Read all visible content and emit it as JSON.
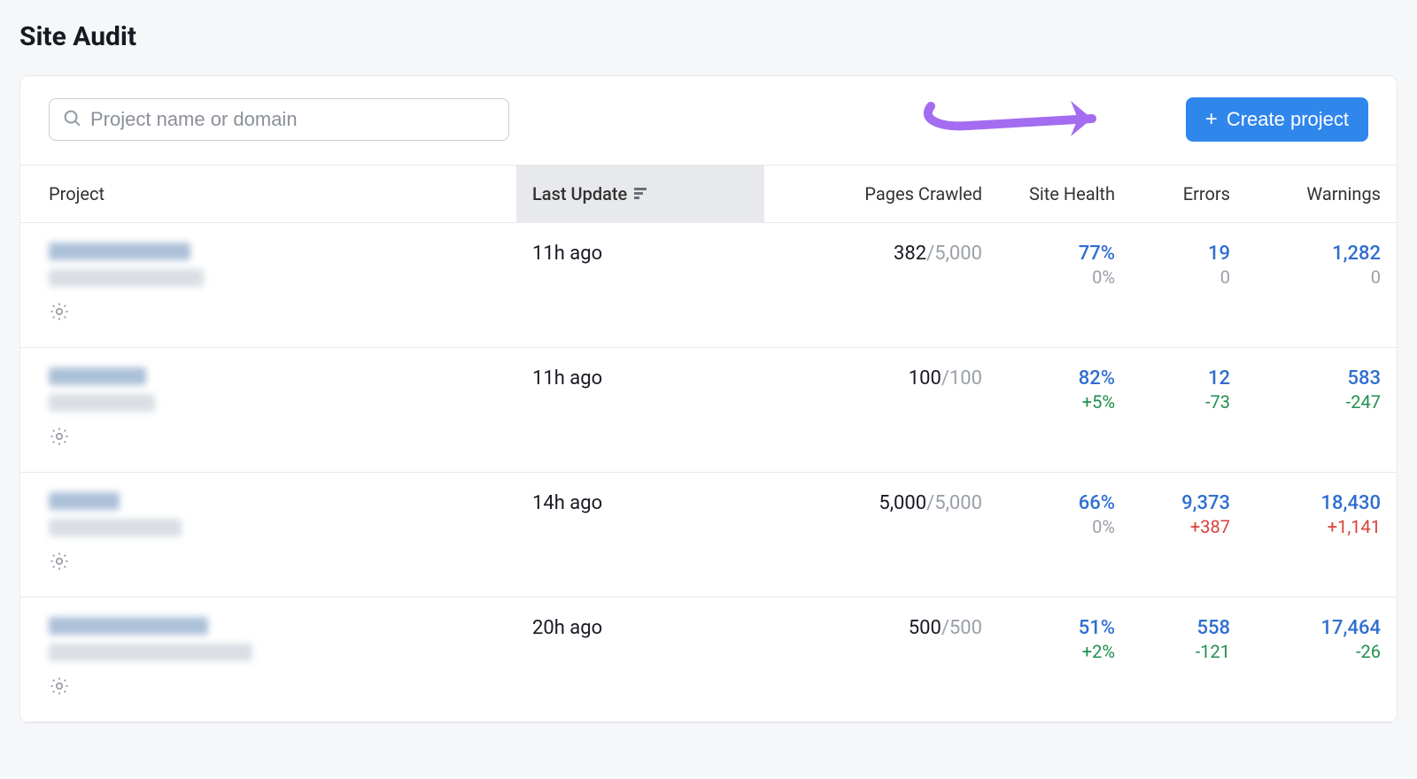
{
  "page": {
    "title": "Site Audit"
  },
  "search": {
    "placeholder": "Project name or domain"
  },
  "actions": {
    "create_label": "Create project"
  },
  "columns": {
    "project": "Project",
    "last_update": "Last Update",
    "pages_crawled": "Pages Crawled",
    "site_health": "Site Health",
    "errors": "Errors",
    "warnings": "Warnings"
  },
  "annotation": {
    "type": "arrow",
    "points_to": "create-project-button"
  },
  "rows": [
    {
      "last_update": "11h ago",
      "pages_crawled": {
        "count": "382",
        "limit": "5,000"
      },
      "site_health": {
        "value": "77%",
        "delta": "0%",
        "delta_sign": "neutral"
      },
      "errors": {
        "value": "19",
        "delta": "0",
        "delta_sign": "neutral"
      },
      "warnings": {
        "value": "1,282",
        "delta": "0",
        "delta_sign": "neutral"
      }
    },
    {
      "last_update": "11h ago",
      "pages_crawled": {
        "count": "100",
        "limit": "100"
      },
      "site_health": {
        "value": "82%",
        "delta": "+5%",
        "delta_sign": "pos"
      },
      "errors": {
        "value": "12",
        "delta": "-73",
        "delta_sign": "pos"
      },
      "warnings": {
        "value": "583",
        "delta": "-247",
        "delta_sign": "pos"
      }
    },
    {
      "last_update": "14h ago",
      "pages_crawled": {
        "count": "5,000",
        "limit": "5,000"
      },
      "site_health": {
        "value": "66%",
        "delta": "0%",
        "delta_sign": "neutral"
      },
      "errors": {
        "value": "9,373",
        "delta": "+387",
        "delta_sign": "neg"
      },
      "warnings": {
        "value": "18,430",
        "delta": "+1,141",
        "delta_sign": "neg"
      }
    },
    {
      "last_update": "20h ago",
      "pages_crawled": {
        "count": "500",
        "limit": "500"
      },
      "site_health": {
        "value": "51%",
        "delta": "+2%",
        "delta_sign": "pos"
      },
      "errors": {
        "value": "558",
        "delta": "-121",
        "delta_sign": "pos"
      },
      "warnings": {
        "value": "17,464",
        "delta": "-26",
        "delta_sign": "pos"
      }
    }
  ]
}
